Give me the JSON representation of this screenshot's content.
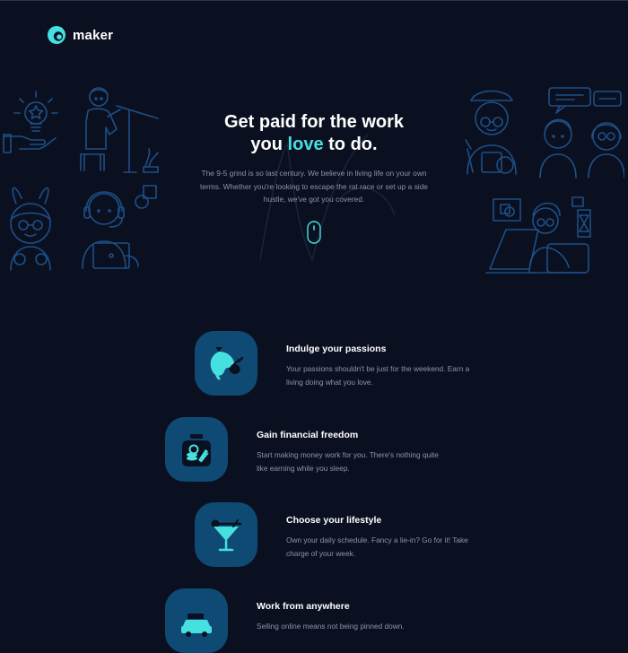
{
  "brand": {
    "name": "maker"
  },
  "hero": {
    "title_line1": "Get paid for the work",
    "title_line2_pre": "you ",
    "title_line2_highlight": "love",
    "title_line2_post": " to do.",
    "subtitle": "The 9-5 grind is so last century. We believe in living life on your own terms. Whether you're looking to escape the rat race or set up a side hustle, we've got you covered."
  },
  "features": [
    {
      "title": "Indulge your passions",
      "description": "Your passions shouldn't be just for the weekend. Earn a living doing what you love.",
      "icon": "paint-splash-icon"
    },
    {
      "title": "Gain financial freedom",
      "description": "Start making money work for you. There's nothing quite like earning while you sleep.",
      "icon": "money-jar-icon"
    },
    {
      "title": "Choose your lifestyle",
      "description": "Own your daily schedule. Fancy a lie-in? Go for it! Take charge of your week.",
      "icon": "cocktail-icon"
    },
    {
      "title": "Work from anywhere",
      "description": "Selling online means not being pinned down.",
      "icon": "car-icon"
    }
  ],
  "colors": {
    "background": "#0b1021",
    "accent": "#46e0e0",
    "icon_tile": "#0e4a73",
    "illustration_stroke": "#1d4f86",
    "muted_text": "#8d95aa"
  }
}
